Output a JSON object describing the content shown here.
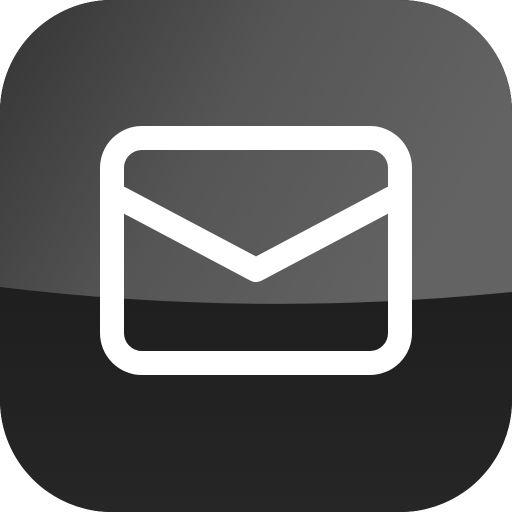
{
  "app_icon": {
    "name": "Mail",
    "icon": "envelope-icon",
    "colors": {
      "background_top": "#5a5a5a",
      "background_top_left": "#3a3a3a",
      "background_bottom": "#1e1e1e",
      "glyph": "#ffffff"
    }
  }
}
